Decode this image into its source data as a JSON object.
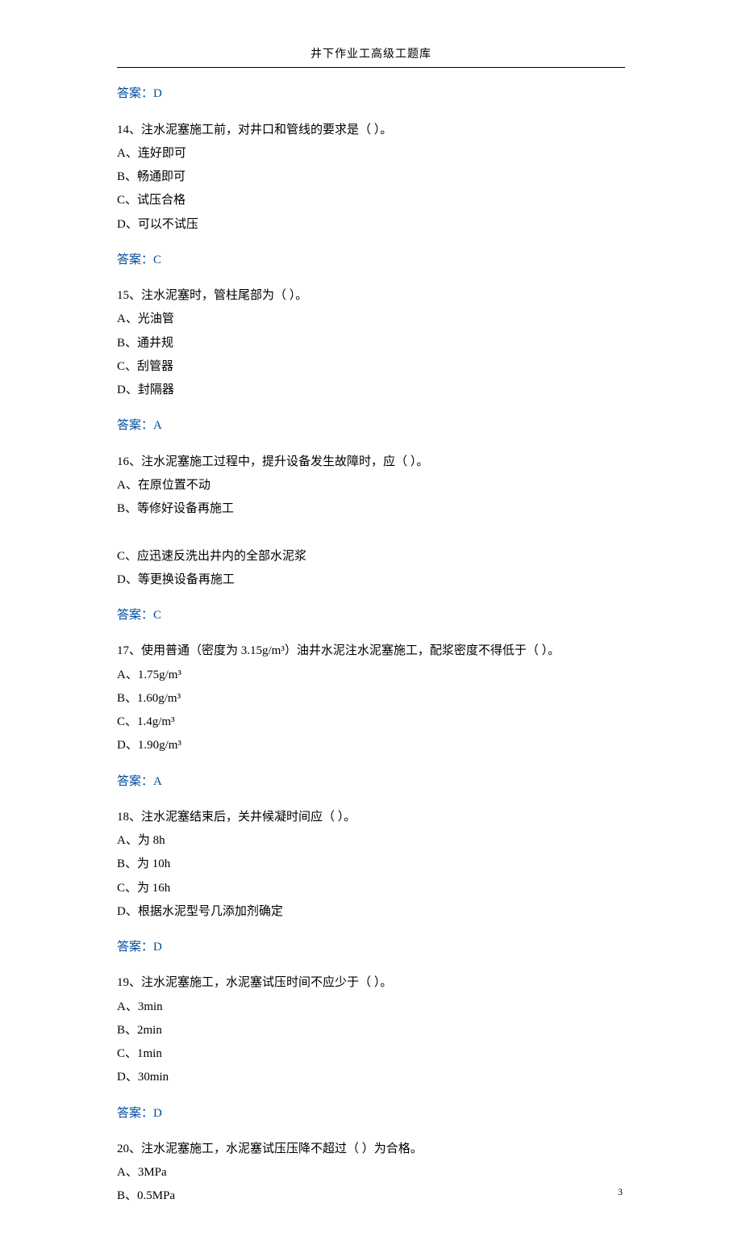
{
  "header": {
    "title": "井下作业工高级工题库"
  },
  "answer_label": "答案：",
  "page_number": "3",
  "q13": {
    "answer": "D"
  },
  "q14": {
    "text": "14、注水泥塞施工前，对井口和管线的要求是（      ）。",
    "A": "A、连好即可",
    "B": "B、畅通即可",
    "C": "C、试压合格",
    "D": "D、可以不试压",
    "answer": "C"
  },
  "q15": {
    "text": "15、注水泥塞时，管柱尾部为（       ）。",
    "A": "A、光油管",
    "B": "B、通井规",
    "C": "C、刮管器",
    "D": "D、封隔器",
    "answer": "A"
  },
  "q16": {
    "text": "16、注水泥塞施工过程中，提升设备发生故障时，应（      ）。",
    "A": "A、在原位置不动",
    "B": "B、等修好设备再施工",
    "C": "C、应迅速反洗出井内的全部水泥浆",
    "D": "D、等更换设备再施工",
    "answer": "C"
  },
  "q17": {
    "text": "17、使用普通（密度为 3.15g/m³）油井水泥注水泥塞施工，配浆密度不得低于（  ）。",
    "A": "A、1.75g/m³",
    "B": "B、1.60g/m³",
    "C": "C、1.4g/m³",
    "D": "D、1.90g/m³",
    "answer": "A"
  },
  "q18": {
    "text": "18、注水泥塞结束后，关井候凝时间应（      ）。",
    "A": "A、为 8h",
    "B": "B、为 10h",
    "C": "C、为 16h",
    "D": "D、根据水泥型号几添加剂确定",
    "answer": "D"
  },
  "q19": {
    "text": "19、注水泥塞施工，水泥塞试压时间不应少于（     ）。",
    "A": "A、3min",
    "B": "B、2min",
    "C": "C、1min",
    "D": "D、30min",
    "answer": "D"
  },
  "q20": {
    "text": "20、注水泥塞施工，水泥塞试压压降不超过（       ）为合格。",
    "A": "A、3MPa",
    "B": "B、0.5MPa"
  }
}
